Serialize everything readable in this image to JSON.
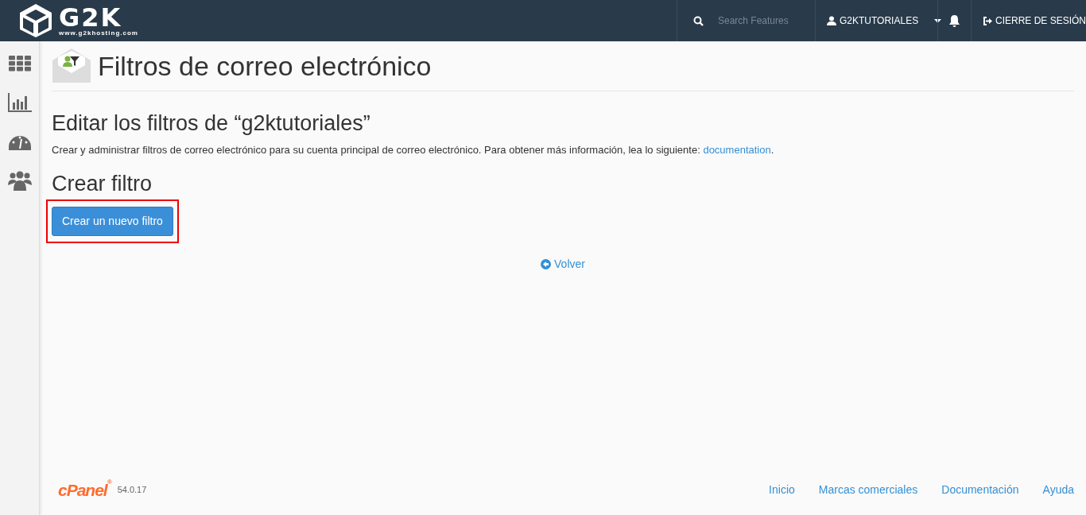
{
  "brand": {
    "logo_text": "G2K",
    "tagline": "www.g2khosting.com"
  },
  "header": {
    "search": {
      "placeholder": "Search Features"
    },
    "user": "G2KTUTORIALES",
    "logout": "CIERRE DE SESIÓN"
  },
  "sidebar": {
    "items": [
      {
        "kind": "grid",
        "selected": false
      },
      {
        "kind": "stats",
        "selected": false
      },
      {
        "kind": "gauge",
        "selected": false
      },
      {
        "kind": "users",
        "selected": false
      }
    ]
  },
  "page": {
    "title": "Filtros de correo electrónico",
    "section_title": "Editar los filtros de “g2ktutoriales”",
    "description": "Crear y administrar filtros de correo electrónico para su cuenta principal de correo electrónico. Para obtener más información, lea lo siguiente: ",
    "description_link": "documentation",
    "description_end": ".",
    "create_title": "Crear filtro",
    "create_button": {
      "label": "Crear un nuevo filtro",
      "highlighted": true
    },
    "back_link": "Volver"
  },
  "footer": {
    "logo_text": "cPanel",
    "logo_mark": "®",
    "version": "54.0.17",
    "links": [
      "Inicio",
      "Marcas comerciales",
      "Documentación",
      "Ayuda"
    ]
  }
}
